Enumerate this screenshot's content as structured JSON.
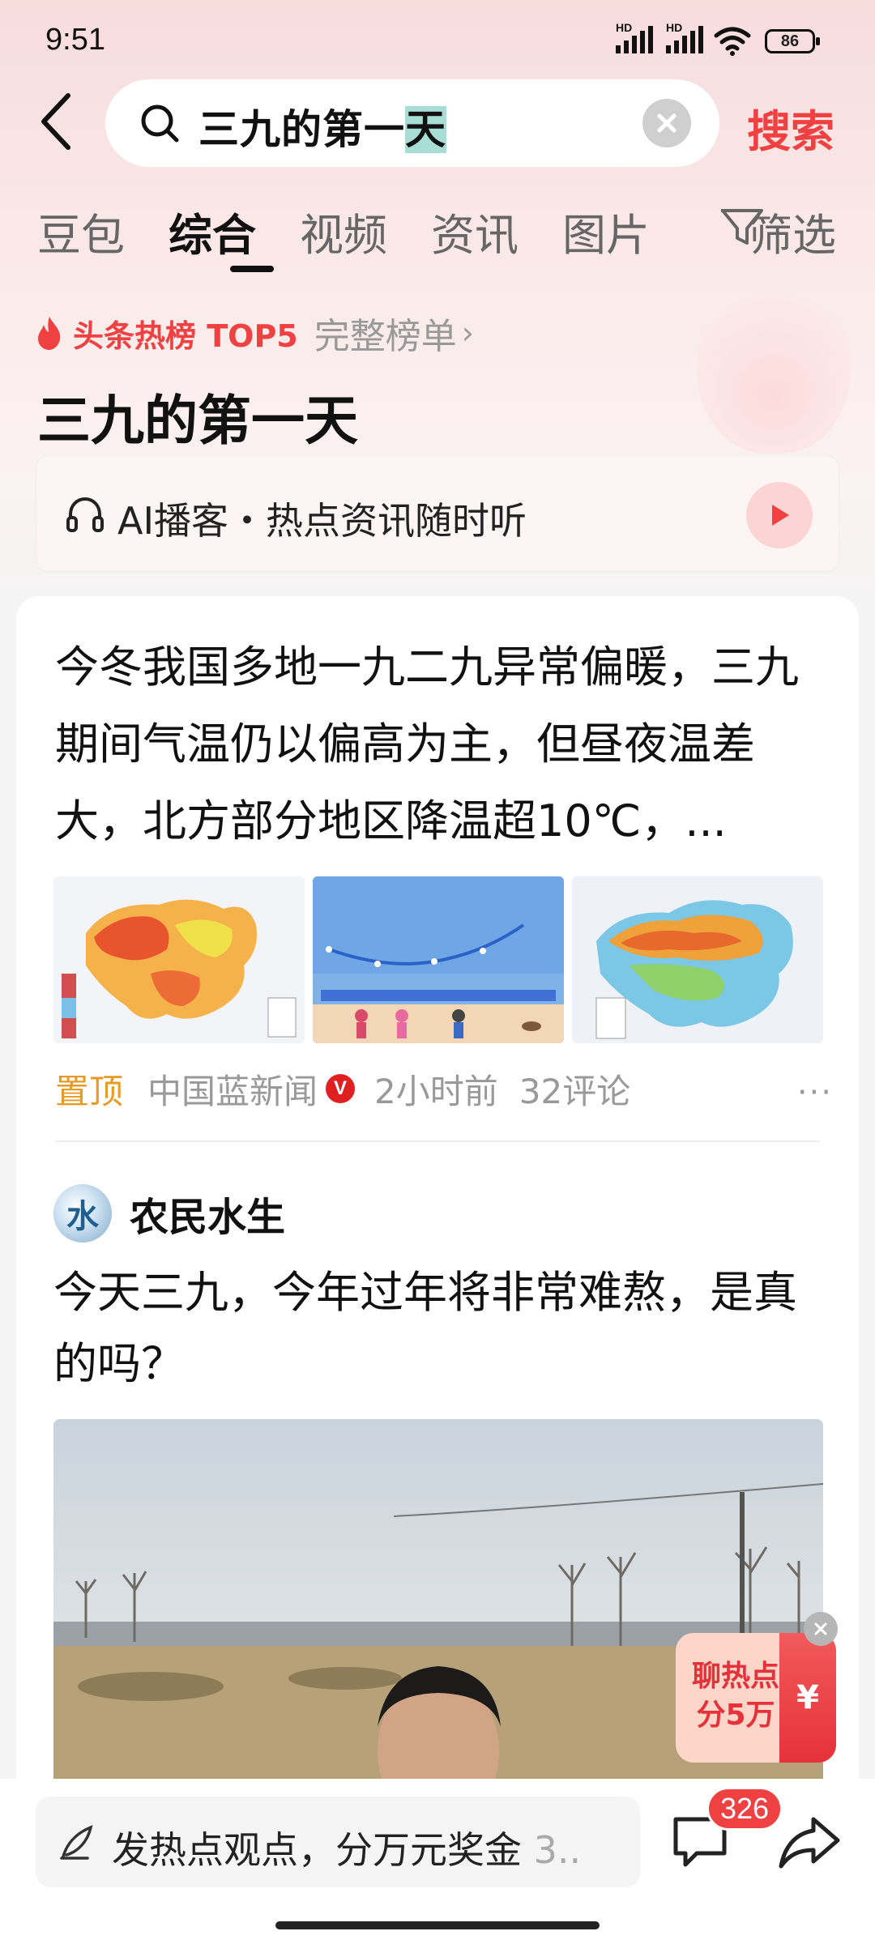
{
  "status_bar": {
    "time": "9:51",
    "battery": "86",
    "hd1": "HD",
    "hd2": "HD"
  },
  "search": {
    "query_plain": "三九的第一",
    "query_selected": "天",
    "submit_label": "搜索"
  },
  "tabs": [
    {
      "label": "豆包"
    },
    {
      "label": "综合",
      "active": true
    },
    {
      "label": "视频"
    },
    {
      "label": "资讯"
    },
    {
      "label": "图片"
    },
    {
      "label": "筛选"
    }
  ],
  "hot": {
    "label": "头条热榜 TOP5",
    "full_list": "完整榜单",
    "title": "三九的第一天"
  },
  "ai_podcast": {
    "text": "AI播客・热点资讯随时听"
  },
  "article": {
    "title": "今冬我国多地一九二九异常偏暖，三九期间气温仍以偏高为主，但昼夜温差大，北方部分地区降温超10℃，...",
    "pin": "置顶",
    "source": "中国蓝新闻",
    "verified": "V",
    "time": "2小时前",
    "comments": "32评论",
    "more": "···"
  },
  "post": {
    "author": "农民水生",
    "avatar_char": "水",
    "title": "今天三九，今年过年将非常难熬，是真的吗？"
  },
  "reward": {
    "line1": "聊热点",
    "line2": "分5万",
    "currency": "¥"
  },
  "bottom": {
    "comment_placeholder": "发热点观点，分万元奖金",
    "comment_tail": "3..",
    "comment_count": "326"
  },
  "colors": {
    "accent": "#f04142",
    "pin": "#e89a26"
  },
  "icons": [
    "back-icon",
    "search-icon",
    "clear-icon",
    "filter-icon",
    "flame-icon",
    "headphone-icon",
    "play-icon",
    "more-icon",
    "pen-icon",
    "chat-icon",
    "share-icon",
    "close-icon"
  ]
}
